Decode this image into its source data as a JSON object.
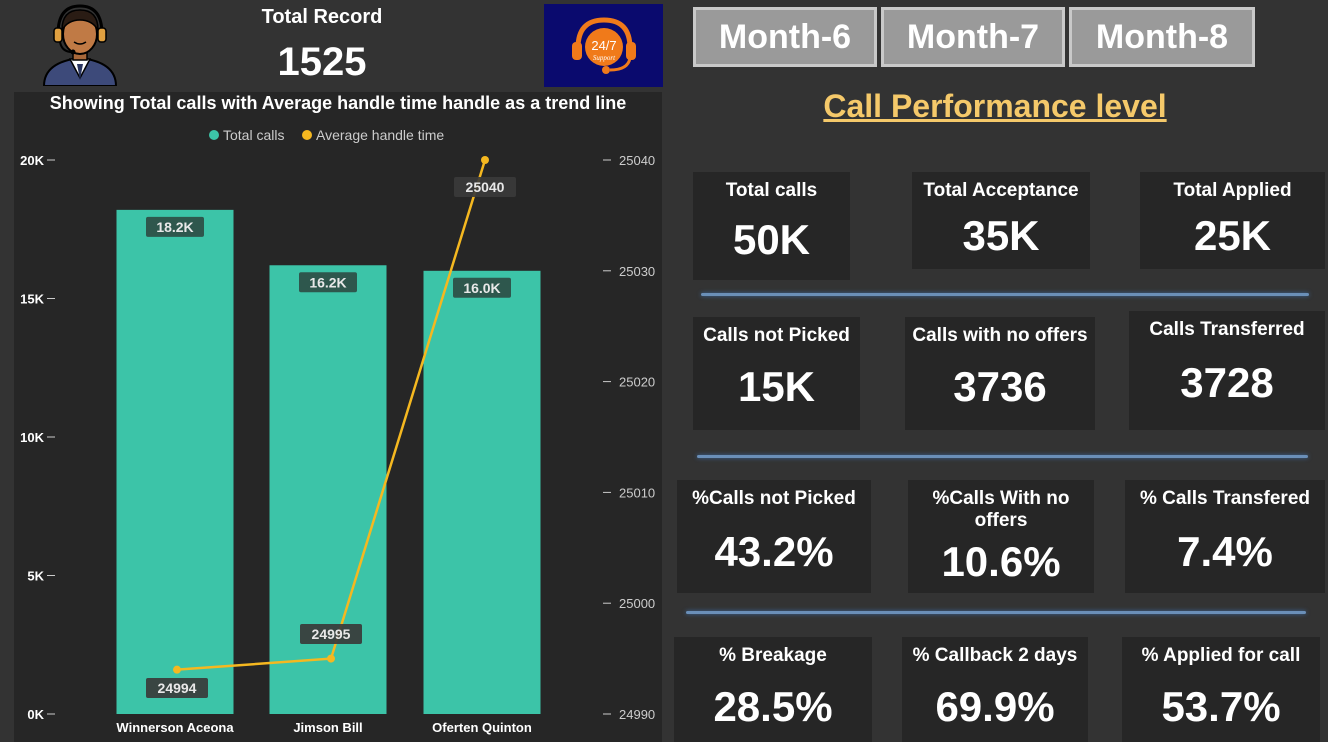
{
  "header": {
    "total_record_title": "Total Record",
    "total_record_value": "1525",
    "agent_icon": "call-center-agent-icon",
    "support_logo_text": "24/7",
    "support_logo_subtext": "Support"
  },
  "months": [
    {
      "label": "Month-6"
    },
    {
      "label": "Month-7"
    },
    {
      "label": "Month-8"
    }
  ],
  "chart_data": {
    "type": "bar",
    "title": "Showing Total calls with Average handle time handle as a trend line",
    "categories": [
      "Winnerson Aceona",
      "Jimson Bill",
      "Oferten Quinton"
    ],
    "series": [
      {
        "name": "Total calls",
        "type": "bar",
        "values": [
          18200,
          16200,
          16000
        ],
        "labels": [
          "18.2K",
          "16.2K",
          "16.0K"
        ],
        "color": "#3cc4a8"
      },
      {
        "name": "Average handle time",
        "type": "line",
        "values": [
          24994,
          24995,
          25040
        ],
        "labels": [
          "24994",
          "24995",
          "25040"
        ],
        "color": "#f5b820"
      }
    ],
    "y_left": {
      "ticks": [
        "0K",
        "5K",
        "10K",
        "15K",
        "20K"
      ],
      "min": 0,
      "max": 20000
    },
    "y_right": {
      "ticks": [
        "24990",
        "25000",
        "25010",
        "25020",
        "25030",
        "25040"
      ],
      "min": 24990,
      "max": 25040
    },
    "legend": "top-center",
    "grid": false
  },
  "performance": {
    "heading": "Call Performance level",
    "cards": [
      {
        "label": "Total calls",
        "value": "50K"
      },
      {
        "label": "Total Acceptance",
        "value": "35K"
      },
      {
        "label": "Total Applied",
        "value": "25K"
      },
      {
        "label": "Calls not Picked",
        "value": "15K"
      },
      {
        "label": "Calls with no offers",
        "value": "3736"
      },
      {
        "label": "Calls Transferred",
        "value": "3728"
      },
      {
        "label": "%Calls not Picked",
        "value": "43.2%"
      },
      {
        "label": "%Calls With no offers",
        "value": "10.6%"
      },
      {
        "label": "% Calls Transfered",
        "value": "7.4%"
      },
      {
        "label": "% Breakage",
        "value": "28.5%"
      },
      {
        "label": "% Callback 2 days",
        "value": "69.9%"
      },
      {
        "label": "% Applied for call",
        "value": "53.7%"
      }
    ]
  }
}
